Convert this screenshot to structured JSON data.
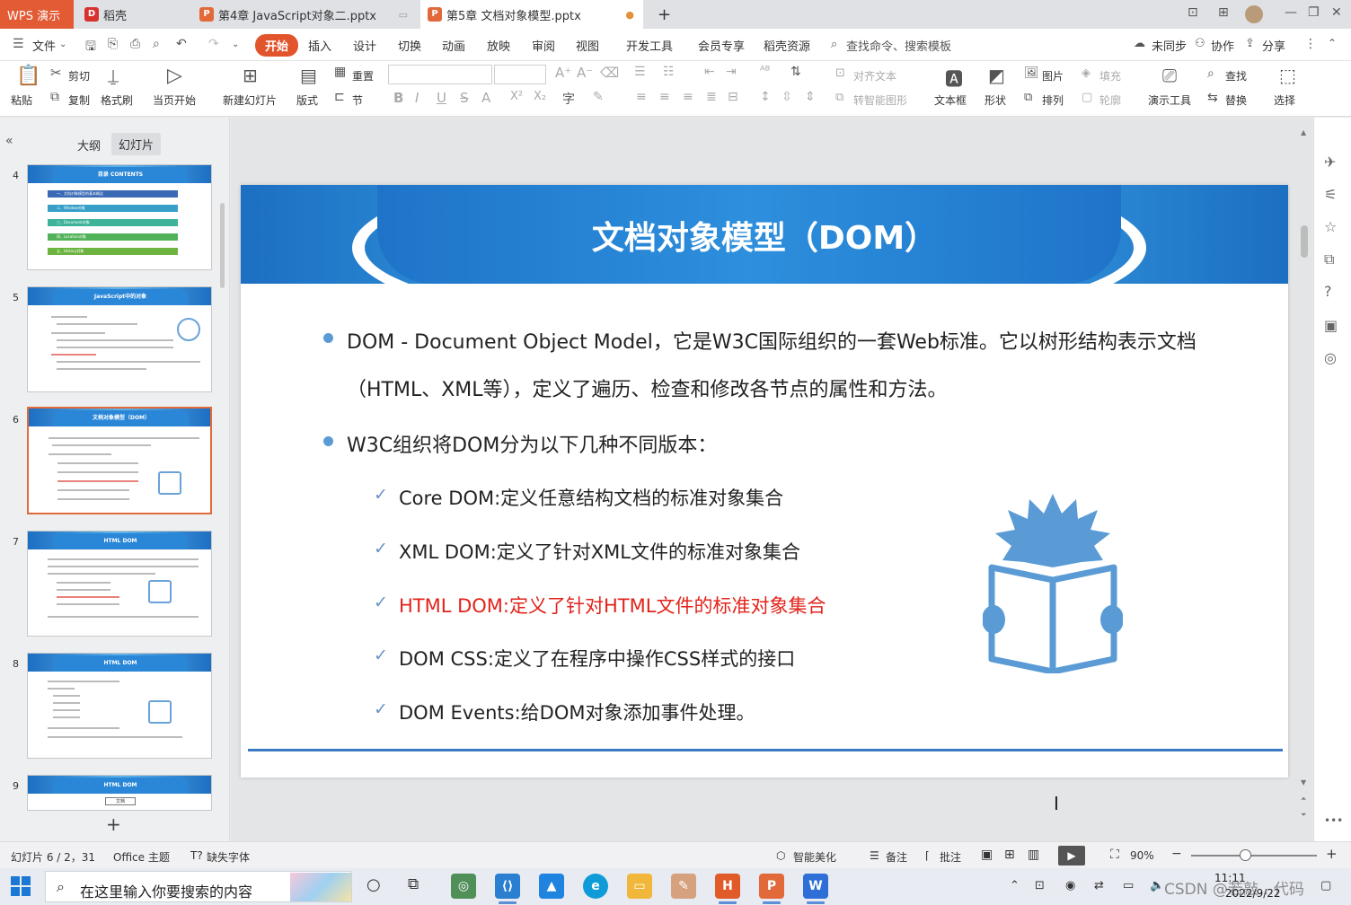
{
  "tabs": {
    "wps": "WPS 演示",
    "daoke": "稻壳",
    "file1": "第4章 JavaScript对象二.pptx",
    "file2": "第5章 文档对象模型.pptx",
    "new_tab": "+"
  },
  "menu": {
    "file": "文件",
    "items": [
      "开始",
      "插入",
      "设计",
      "切换",
      "动画",
      "放映",
      "审阅",
      "视图",
      "开发工具",
      "会员专享",
      "稻壳资源"
    ],
    "search": "查找命令、搜索模板",
    "sync": "未同步",
    "collab": "协作",
    "share": "分享"
  },
  "ribbon": {
    "paste": "粘贴",
    "cut": "剪切",
    "copy": "复制",
    "format_painter": "格式刷",
    "from_current": "当页开始",
    "new_slide": "新建幻灯片",
    "layout": "版式",
    "reset": "重置",
    "section": "节",
    "align_text": "对齐文本",
    "smartart": "转智能图形",
    "textbox": "文本框",
    "shape": "形状",
    "picture": "图片",
    "arrange": "排列",
    "fill": "填充",
    "outline": "轮廓",
    "presenter_tools": "演示工具",
    "find": "查找",
    "replace": "替换",
    "select": "选择"
  },
  "left_panel": {
    "tab_outline": "大纲",
    "tab_slides": "幻灯片",
    "slide_numbers": [
      "4",
      "5",
      "6",
      "7",
      "8",
      "9"
    ],
    "thumb_titles": [
      "目录  CONTENTS",
      "JavaScript中的对象",
      "文档对象模型（DOM）",
      "HTML DOM",
      "HTML DOM",
      "HTML DOM"
    ],
    "thumb4_items": [
      "一、文档对象模型的基本概念",
      "二、Window对象",
      "三、Document对象",
      "四、Location对象",
      "五、History对象"
    ],
    "thumb9_box": "文档",
    "add_slide": "+"
  },
  "slide": {
    "title": "文档对象模型（DOM）",
    "bullet1_line1": "DOM - Document Object Model，它是W3C国际组织的一套Web标准。它以树形结构表示文档",
    "bullet1_line2": "（HTML、XML等），定义了遍历、检查和修改各节点的属性和方法。",
    "bullet2": "W3C组织将DOM分为以下几种不同版本：",
    "subitems": [
      "Core DOM:定义任意结构文档的标准对象集合",
      "XML DOM:定义了针对XML文件的标准对象集合",
      "HTML DOM:定义了针对HTML文件的标准对象集合",
      "DOM CSS:定义了在程序中操作CSS样式的接口",
      "DOM Events:给DOM对象添加事件处理。"
    ],
    "highlight_color": "#e2231a"
  },
  "statusbar": {
    "slide_info": "幻灯片 6 / 2，31",
    "theme": "Office 主题",
    "missing_font": "缺失字体",
    "beautify": "智能美化",
    "notes": "备注",
    "comments": "批注",
    "zoom": "90%"
  },
  "taskbar": {
    "search_placeholder": "在这里输入你要搜索的内容",
    "time": "11:11",
    "date": "2022/9/22"
  },
  "watermark": "CSDN @若敲…代码"
}
